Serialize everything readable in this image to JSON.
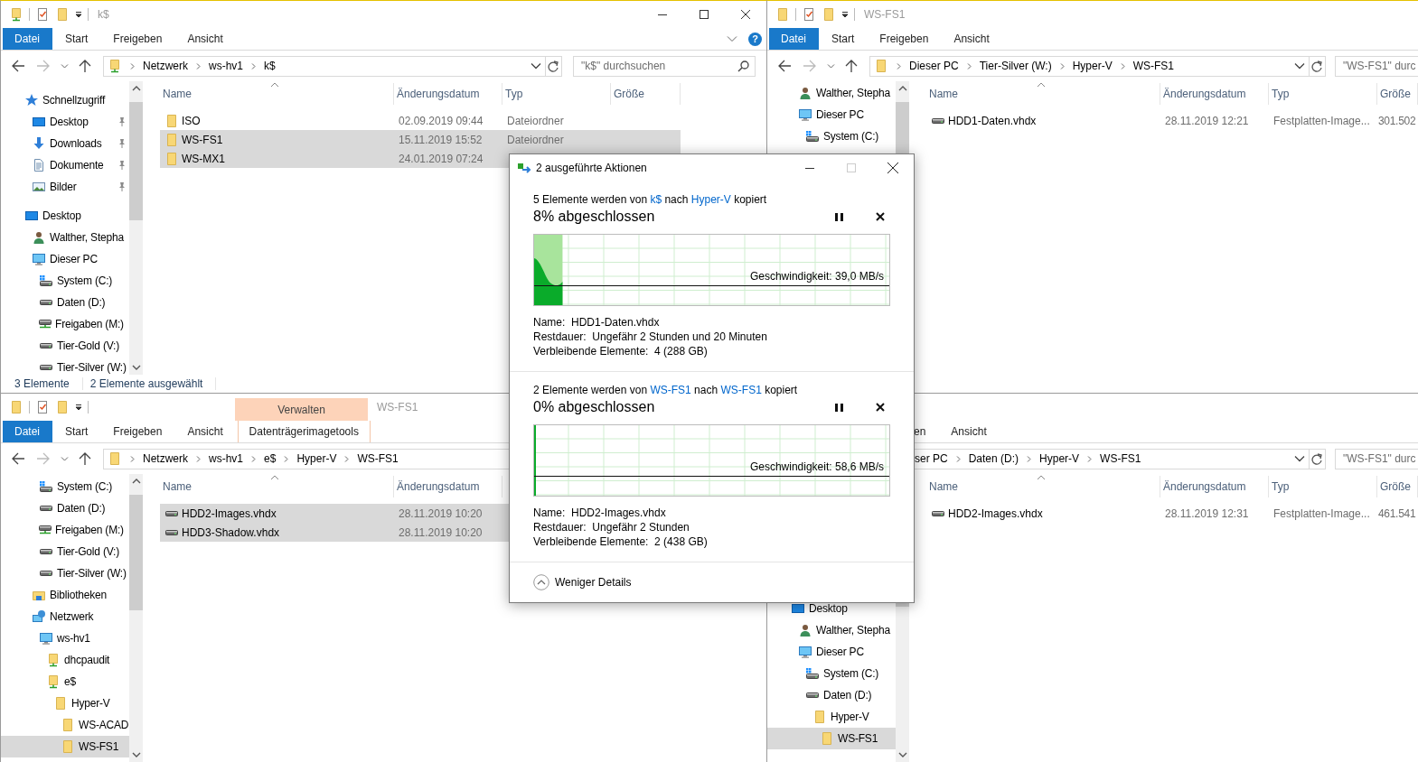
{
  "windows": [
    {
      "title": "k$",
      "quick_access": true,
      "caption_buttons": true,
      "help": "?",
      "nav_buttons": true,
      "ribbon_tabs": [
        {
          "kind": "file",
          "label": "Datei"
        },
        {
          "kind": "tab",
          "label": "Start"
        },
        {
          "kind": "tab",
          "label": "Freigeben"
        },
        {
          "kind": "tab",
          "label": "Ansicht"
        }
      ],
      "address": {
        "kind": "share",
        "parts": [
          "Netzwerk",
          "ws-hv1",
          "k$"
        ],
        "tools": true
      },
      "search": {
        "placeholder": "\"k$\" durchsuchen",
        "icon": true
      },
      "nav": [
        {
          "label": "Schnellzugriff",
          "kind": "star",
          "selected": false,
          "children": [
            {
              "label": "Desktop",
              "kind": "desktop",
              "pinned": true,
              "selected": false
            },
            {
              "label": "Downloads",
              "kind": "download",
              "pinned": true,
              "selected": false
            },
            {
              "label": "Dokumente",
              "kind": "document",
              "pinned": true,
              "selected": false
            },
            {
              "label": "Bilder",
              "kind": "picture",
              "pinned": true,
              "selected": false
            }
          ]
        },
        {
          "label": "Desktop",
          "kind": "desktop",
          "selected": false,
          "children": [
            {
              "label": "Walther, Stepha",
              "kind": "user",
              "selected": false
            },
            {
              "label": "Dieser PC",
              "kind": "pc",
              "selected": false,
              "children": [
                {
                  "label": "System (C:)",
                  "kind": "drive-system",
                  "selected": false
                },
                {
                  "label": "Daten (D:)",
                  "kind": "drive",
                  "selected": false
                },
                {
                  "label": "Freigaben (M:)",
                  "kind": "drive-net",
                  "selected": false
                },
                {
                  "label": "Tier-Gold (V:)",
                  "kind": "drive",
                  "selected": false
                },
                {
                  "label": "Tier-Silver (W:)",
                  "kind": "drive",
                  "selected": false
                }
              ]
            }
          ]
        }
      ],
      "columns": [
        "Name",
        "Änderungsdatum",
        "Typ",
        "Größe"
      ],
      "rows": [
        {
          "name": "ISO",
          "kind": "folder",
          "date": "02.09.2019 09:44",
          "type": "Dateiordner",
          "selected": false
        },
        {
          "name": "WS-FS1",
          "kind": "folder",
          "date": "15.11.2019 15:52",
          "type": "Dateiordner",
          "selected": true
        },
        {
          "name": "WS-MX1",
          "kind": "folder",
          "date": "24.01.2019 07:24",
          "selected": true
        }
      ],
      "status": [
        "3 Elemente",
        "2 Elemente ausgewählt"
      ]
    },
    {
      "title": "WS-FS1",
      "quick_access": true,
      "nav_buttons": true,
      "ribbon_tabs": [
        {
          "kind": "file",
          "label": "Datei"
        },
        {
          "kind": "tab",
          "label": "Start"
        },
        {
          "kind": "tab",
          "label": "Freigeben"
        },
        {
          "kind": "tab",
          "label": "Ansicht"
        }
      ],
      "address": {
        "kind": "folder",
        "parts": [
          "Dieser PC",
          "Tier-Silver (W:)",
          "Hyper-V",
          "WS-FS1"
        ],
        "tools": true
      },
      "search": {
        "placeholder": "\"WS-FS1\" durc"
      },
      "nav": [
        {
          "children": [
            {
              "label": "Walther, Stepha",
              "kind": "user",
              "selected": false
            },
            {
              "label": "Dieser PC",
              "kind": "pc",
              "selected": false,
              "children": [
                {
                  "label": "System (C:)",
                  "kind": "drive-system",
                  "selected": false
                }
              ]
            }
          ]
        }
      ],
      "columns": [
        "Name",
        "Änderungsdatum",
        "Typ",
        "Größe"
      ],
      "rows": [
        {
          "name": "HDD1-Daten.vhdx",
          "kind": "disk",
          "date": "28.11.2019 12:21",
          "type": "Festplatten-Image...",
          "size": "301.502",
          "selected": false
        }
      ]
    },
    {
      "title": "WS-FS1",
      "quick_access": true,
      "nav_buttons": true,
      "ribbon_tabs": [
        {
          "kind": "file",
          "label": "Datei"
        },
        {
          "kind": "tab",
          "label": "Start"
        },
        {
          "kind": "tab",
          "label": "Freigeben"
        },
        {
          "kind": "tab",
          "label": "Ansicht"
        },
        {
          "kind": "context",
          "label": "Datenträgerimagetools",
          "group": "Verwalten"
        }
      ],
      "address": {
        "kind": "folder",
        "parts": [
          "Netzwerk",
          "ws-hv1",
          "e$",
          "Hyper-V",
          "WS-FS1"
        ]
      },
      "nav": [
        {
          "children": [
            {
              "children": [
                {
                  "label": "System (C:)",
                  "kind": "drive-system",
                  "selected": false
                },
                {
                  "label": "Daten (D:)",
                  "kind": "drive",
                  "selected": false
                },
                {
                  "label": "Freigaben (M:)",
                  "kind": "drive-net",
                  "selected": false
                },
                {
                  "label": "Tier-Gold (V:)",
                  "kind": "drive",
                  "selected": false
                },
                {
                  "label": "Tier-Silver (W:)",
                  "kind": "drive",
                  "selected": false
                }
              ]
            },
            {
              "label": "Bibliotheken",
              "kind": "library",
              "selected": false
            },
            {
              "label": "Netzwerk",
              "kind": "network",
              "selected": false,
              "children": [
                {
                  "label": "ws-hv1",
                  "kind": "pc",
                  "selected": false,
                  "children": [
                    {
                      "label": "dhcpaudit",
                      "kind": "share",
                      "selected": false
                    },
                    {
                      "label": "e$",
                      "kind": "share",
                      "selected": false,
                      "children": [
                        {
                          "label": "Hyper-V",
                          "kind": "folder",
                          "selected": false,
                          "children": [
                            {
                              "label": "WS-ACAD",
                              "kind": "folder",
                              "selected": false
                            },
                            {
                              "label": "WS-FS1",
                              "kind": "folder",
                              "selected": true
                            }
                          ]
                        }
                      ]
                    }
                  ]
                }
              ]
            }
          ]
        }
      ],
      "columns": [
        "Name",
        "Änderungsdatum"
      ],
      "rows": [
        {
          "name": "HDD2-Images.vhdx",
          "kind": "disk",
          "date": "28.11.2019 10:20",
          "selected": true
        },
        {
          "name": "HDD3-Shadow.vhdx",
          "kind": "disk",
          "date": "28.11.2019 10:20",
          "selected": true
        }
      ]
    },
    {
      "ribbon_tabs": [
        {
          "kind": "tab",
          "label": "en"
        },
        {
          "kind": "tab",
          "label": "Ansicht"
        }
      ],
      "address": {
        "kind": "none",
        "parts": [
          "ser PC",
          "Daten (D:)",
          "Hyper-V",
          "WS-FS1"
        ],
        "tools": true
      },
      "search": {
        "placeholder": "\"WS-FS1\" durc"
      },
      "nav": [
        {
          "label": "Desktop",
          "kind": "desktop",
          "selected": false,
          "children": [
            {
              "label": "Walther, Stepha",
              "kind": "user",
              "selected": false
            },
            {
              "label": "Dieser PC",
              "kind": "pc",
              "selected": false,
              "children": [
                {
                  "label": "System (C:)",
                  "kind": "drive-system",
                  "selected": false
                },
                {
                  "label": "Daten (D:)",
                  "kind": "drive",
                  "selected": false,
                  "children": [
                    {
                      "label": "Hyper-V",
                      "kind": "folder",
                      "selected": false,
                      "children": [
                        {
                          "label": "WS-FS1",
                          "kind": "folder",
                          "selected": true
                        }
                      ]
                    }
                  ]
                }
              ]
            }
          ]
        }
      ],
      "columns": [
        "Name",
        "Änderungsdatum",
        "Typ",
        "Größe"
      ],
      "rows": [
        {
          "name": "HDD2-Images.vhdx",
          "kind": "disk",
          "date": "28.11.2019 12:31",
          "type": "Festplatten-Image...",
          "size": "461.541",
          "selected": false
        }
      ]
    }
  ],
  "dialog": {
    "title": "2 ausgeführte Aktionen",
    "toggle": "Weniger Details",
    "operations": [
      {
        "count": "5 Elemente werden von",
        "source": "k$",
        "via": "nach",
        "target": "Hyper-V",
        "verb": "kopiert",
        "progress": "8% abgeschlossen",
        "level": 0.08,
        "speed": "Geschwindigkeit: 39,0 MB/s",
        "details": [
          "Name:  HDD1-Daten.vhdx",
          "Restdauer:  Ungefähr 2 Stunden und 20 Minuten",
          "Verbleibende Elemente:  4 (288 GB)"
        ]
      },
      {
        "count": "2 Elemente werden von",
        "source": "WS-FS1",
        "via": "nach",
        "target": "WS-FS1",
        "verb": "kopiert",
        "progress": "0% abgeschlossen",
        "level": 0.0,
        "speed": "Geschwindigkeit: 58,6 MB/s",
        "details": [
          "Name:  HDD2-Images.vhdx",
          "Restdauer:  Ungefähr 2 Stunden",
          "Verbleibende Elemente:  2 (438 GB)"
        ]
      }
    ]
  }
}
